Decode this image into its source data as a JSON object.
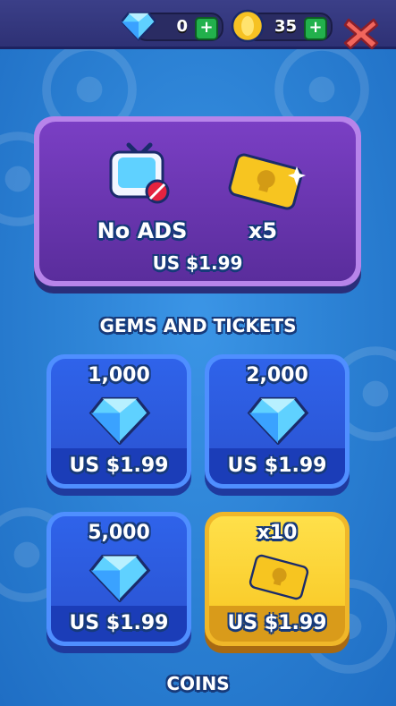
{
  "topbar": {
    "gems_count": "0",
    "coins_count": "35",
    "gems_plus": "+",
    "coins_plus": "+"
  },
  "promo": {
    "no_ads_label": "No ADS",
    "tickets_label": "x5",
    "price": "US $1.99"
  },
  "sections": {
    "gems_and_tickets": "GEMS AND TICKETS",
    "coins": "COINS"
  },
  "cards": [
    {
      "amount": "1,000",
      "price": "US $1.99",
      "icon": "gem-icon"
    },
    {
      "amount": "2,000",
      "price": "US $1.99",
      "icon": "gem-icon"
    },
    {
      "amount": "5,000",
      "price": "US $1.99",
      "icon": "gem-icon"
    },
    {
      "amount": "x10",
      "price": "US $1.99",
      "icon": "ticket-icon"
    }
  ],
  "colors": {
    "background": "#2f86d6",
    "topbar": "#2e3175",
    "promo": "#6a35b0",
    "card_blue": "#2f63ea",
    "card_gold": "#f7c520",
    "close": "#f2665c"
  }
}
